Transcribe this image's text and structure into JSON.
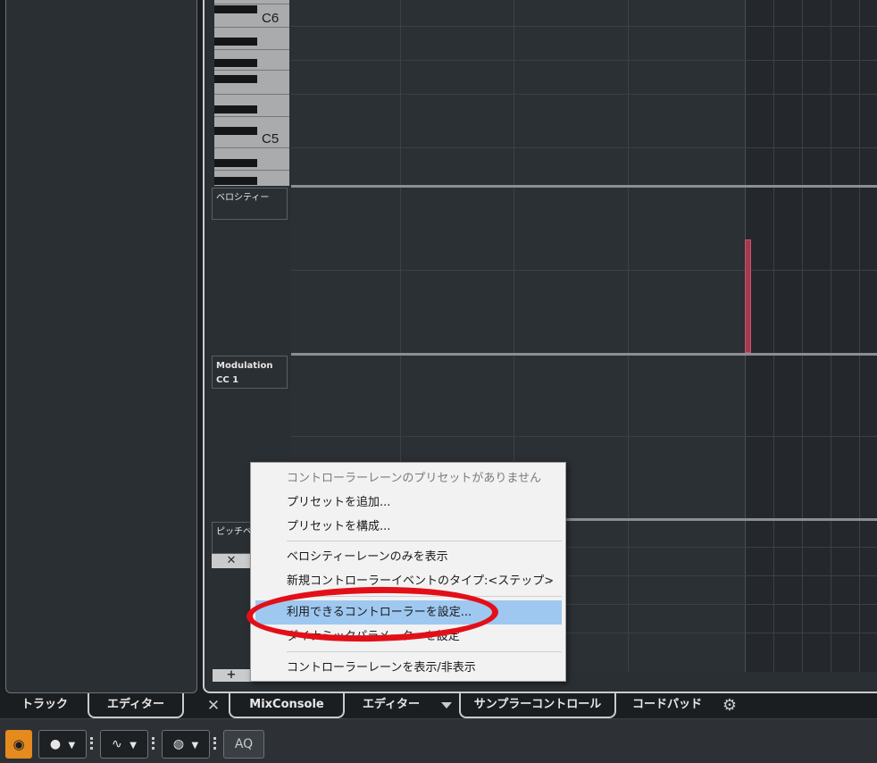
{
  "keyboard": {
    "label_c6": "C6",
    "label_c5": "C5"
  },
  "lanes": {
    "velocity": "ベロシティー",
    "modulation_line1": "Modulation",
    "modulation_line2": "CC 1",
    "pitchbend": "ピッチベン"
  },
  "buttons": {
    "remove_lane": "✕",
    "add_lane": "+"
  },
  "context_menu": {
    "items": [
      "コントローラーレーンのプリセットがありません",
      "プリセットを追加...",
      "プリセットを構成...",
      "ベロシティーレーンのみを表示",
      "新規コントローラーイベントのタイプ:<ステップ>",
      "利用できるコントローラーを設定...",
      "ダイナミックパラメーターを設定",
      "コントローラーレーンを表示/非表示"
    ],
    "submenu_arrow": "›"
  },
  "tabs": {
    "left": [
      "トラック",
      "エディター"
    ],
    "close": "✕",
    "main": [
      "MixConsole",
      "エディター",
      "サンプラーコントロール",
      "コードパッド"
    ]
  },
  "toolbar": {
    "record_icon": "●",
    "dropdown_arrow": "▼",
    "aq_label": "AQ"
  },
  "colors": {
    "highlight": "#9ec8f0",
    "annotation": "#e30f18",
    "velocity_bar": "#a33a4f",
    "orange_button": "#e58a1f"
  }
}
